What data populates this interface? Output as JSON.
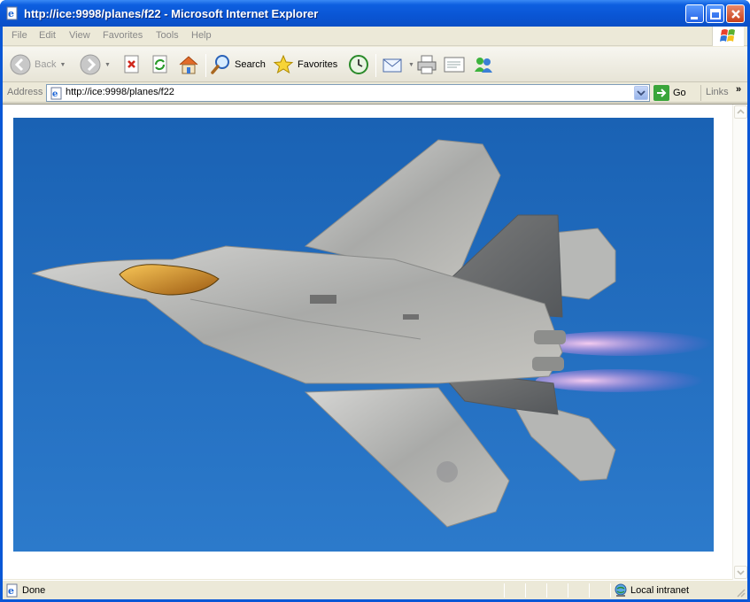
{
  "window": {
    "title": "http://ice:9998/planes/f22 - Microsoft Internet Explorer"
  },
  "menu": {
    "items": [
      "File",
      "Edit",
      "View",
      "Favorites",
      "Tools",
      "Help"
    ]
  },
  "toolbar": {
    "back_label": "Back",
    "search_label": "Search",
    "favorites_label": "Favorites"
  },
  "address": {
    "label": "Address",
    "url": "http://ice:9998/planes/f22",
    "go_label": "Go",
    "links_label": "Links"
  },
  "status": {
    "text": "Done",
    "zone": "Local intranet"
  },
  "colors": {
    "titlebar": "#0a55d4",
    "chrome": "#ece9d8",
    "sky": "#1f6fc0"
  },
  "content": {
    "image_subject": "fighter-jet-photo"
  }
}
